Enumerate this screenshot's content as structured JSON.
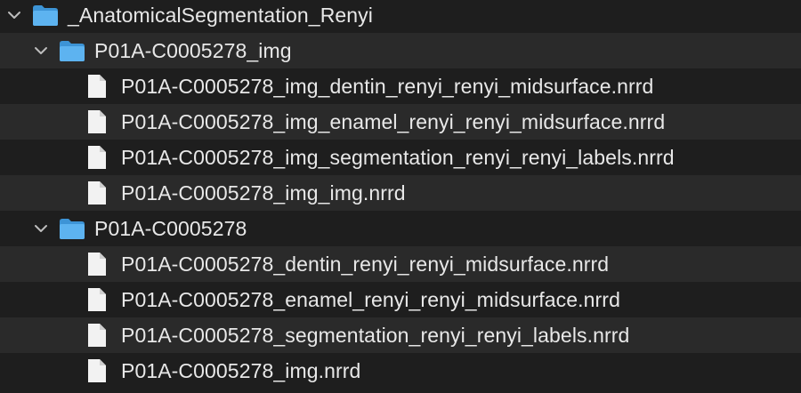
{
  "colors": {
    "background": "#1e1e1e",
    "row_alternate": "#2a2a2a",
    "text": "#e8e8e8",
    "folder_blue": "#4aa6e8",
    "file_white": "#f2f2f2"
  },
  "tree": {
    "root": {
      "name": "_AnatomicalSegmentation_Renyi",
      "icon": "folder-icon",
      "expanded": true
    },
    "folder1": {
      "name": "P01A-C0005278_img",
      "icon": "folder-icon",
      "expanded": true,
      "files": [
        "P01A-C0005278_img_dentin_renyi_renyi_midsurface.nrrd",
        "P01A-C0005278_img_enamel_renyi_renyi_midsurface.nrrd",
        "P01A-C0005278_img_segmentation_renyi_renyi_labels.nrrd",
        "P01A-C0005278_img_img.nrrd"
      ]
    },
    "folder2": {
      "name": "P01A-C0005278",
      "icon": "folder-icon",
      "expanded": true,
      "files": [
        "P01A-C0005278_dentin_renyi_renyi_midsurface.nrrd",
        "P01A-C0005278_enamel_renyi_renyi_midsurface.nrrd",
        "P01A-C0005278_segmentation_renyi_renyi_labels.nrrd",
        "P01A-C0005278_img.nrrd"
      ]
    }
  }
}
